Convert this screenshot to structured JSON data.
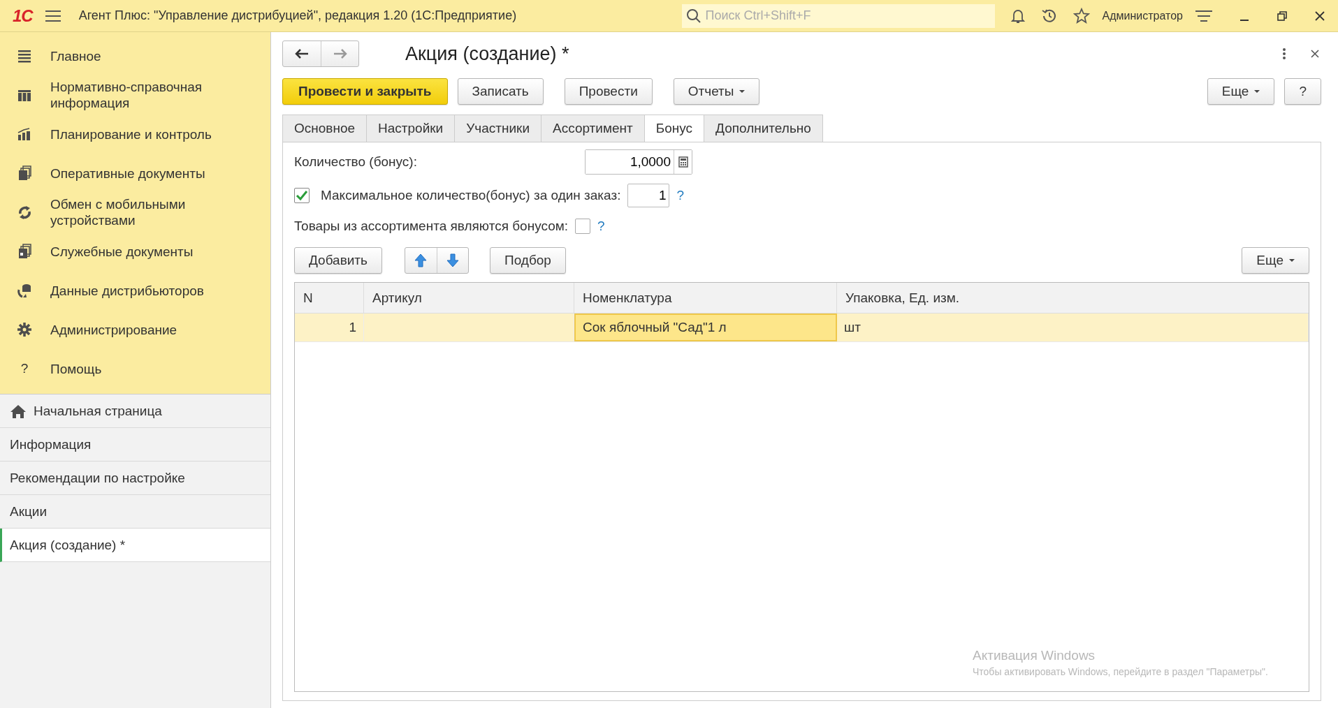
{
  "app_bar": {
    "logo": "1С",
    "title": "Агент Плюс: \"Управление дистрибуцией\", редакция 1.20  (1С:Предприятие)",
    "search": {
      "placeholder": "Поиск Ctrl+Shift+F"
    },
    "user": "Администратор"
  },
  "sections": [
    {
      "label": "Главное"
    },
    {
      "label": "Нормативно-справочная информация"
    },
    {
      "label": "Планирование и контроль"
    },
    {
      "label": "Оперативные документы"
    },
    {
      "label": "Обмен с мобильными устройствами"
    },
    {
      "label": "Служебные документы"
    },
    {
      "label": "Данные дистрибьюторов"
    },
    {
      "label": "Администрирование"
    },
    {
      "label": "Помощь",
      "glyph": "?"
    }
  ],
  "open_windows": [
    {
      "label": "Начальная страница",
      "selected": false
    },
    {
      "label": "Информация",
      "selected": false
    },
    {
      "label": "Рекомендации по настройке",
      "selected": false
    },
    {
      "label": "Акции",
      "selected": false
    },
    {
      "label": "Акция (создание) *",
      "selected": true
    }
  ],
  "form": {
    "title": "Акция (создание) *",
    "buttons": [
      {
        "label": "Провести и закрыть",
        "kind": "primary"
      },
      {
        "label": "Записать",
        "kind": "plain"
      },
      {
        "label": "Провести",
        "kind": "plain"
      },
      {
        "label": "Отчеты",
        "kind": "dropdown"
      }
    ],
    "right_buttons": [
      {
        "label": "Еще",
        "kind": "dropdown"
      },
      {
        "label": "?",
        "kind": "plain"
      }
    ],
    "tabs": [
      {
        "label": "Основное",
        "selected": false
      },
      {
        "label": "Настройки",
        "selected": false
      },
      {
        "label": "Участники",
        "selected": false
      },
      {
        "label": "Ассортимент",
        "selected": false
      },
      {
        "label": "Бонус",
        "selected": true
      },
      {
        "label": "Дополнительно",
        "selected": false
      }
    ],
    "quantity": {
      "label": "Количество (бонус):",
      "value": "1,0000"
    },
    "max_per_order": {
      "label": "Максимальное количество(бонус) за один заказ:",
      "checked": true,
      "value": "1",
      "help": "?"
    },
    "assortment_bonus": {
      "label": "Товары из ассортимента являются бонусом:",
      "checked": false,
      "help": "?"
    },
    "table_toolbar": {
      "add": "Добавить",
      "pick": "Подбор",
      "more": "Еще"
    },
    "table": {
      "columns": [
        "N",
        "Артикул",
        "Номенклатура",
        "Упаковка, Ед. изм."
      ],
      "rows": [
        {
          "n": "1",
          "item": "Сок яблочный \"Сад\"1 л",
          "unit": "шт",
          "selected": true
        }
      ]
    }
  },
  "activation_notice": {
    "title": "Активация Windows",
    "text": "Чтобы активировать Windows, перейдите в раздел \"Параметры\"."
  }
}
